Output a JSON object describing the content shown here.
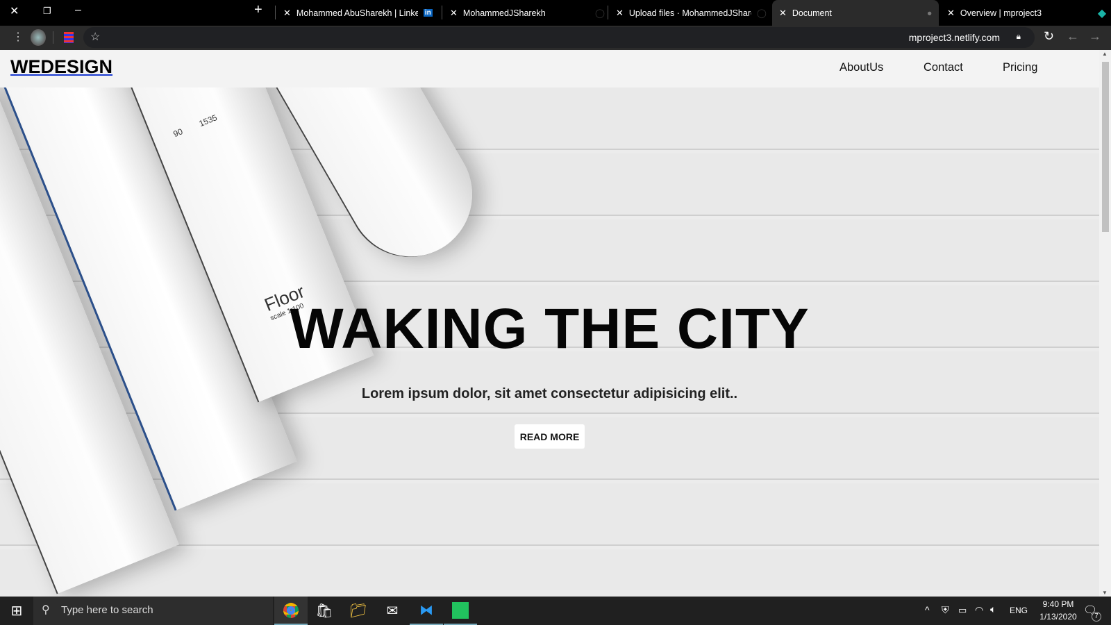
{
  "browser": {
    "tabs": [
      {
        "title": "Mohammed AbuSharekh | Linked",
        "icon": "linkedin-icon"
      },
      {
        "title": "MohammedJSharekh",
        "icon": "github-icon"
      },
      {
        "title": "Upload files · MohammedJSharek",
        "icon": "github-icon"
      },
      {
        "title": "Document",
        "icon": "globe-icon",
        "active": true
      },
      {
        "title": "Overview | mproject3",
        "icon": "netlify-icon"
      }
    ],
    "url": "mproject3.netlify.com"
  },
  "site": {
    "logo": "WEDESIGN",
    "nav": [
      "AboutUs",
      "Contact",
      "Pricing"
    ],
    "hero": {
      "title": "WAKING THE CITY",
      "subtitle": "Lorem ipsum dolor, sit amet consectetur adipisicing elit..",
      "button": "READ MORE"
    },
    "blueprint_text": [
      "Floor",
      "scale 1:100",
      "1535",
      "90"
    ]
  },
  "taskbar": {
    "search_placeholder": "Type here to search",
    "lang": "ENG",
    "time": "9:40 PM",
    "date": "1/13/2020",
    "notifications": "7"
  }
}
